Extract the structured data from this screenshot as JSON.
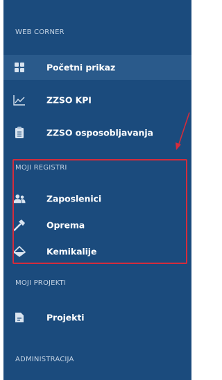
{
  "sidebar": {
    "sections": [
      {
        "header": "WEB CORNER",
        "items": [
          {
            "label": "Početni prikaz",
            "icon": "dashboard-icon"
          },
          {
            "label": "ZZSO KPI",
            "icon": "line-chart-icon"
          },
          {
            "label": "ZZSO osposobljavanja",
            "icon": "clipboard-icon"
          }
        ]
      },
      {
        "header": "MOJI REGISTRI",
        "items": [
          {
            "label": "Zaposlenici",
            "icon": "users-icon"
          },
          {
            "label": "Oprema",
            "icon": "hammer-icon"
          },
          {
            "label": "Kemikalije",
            "icon": "flask-icon"
          }
        ]
      },
      {
        "header": "MOJI PROJEKTI",
        "items": [
          {
            "label": "Projekti",
            "icon": "document-icon"
          }
        ]
      },
      {
        "header": "ADMINISTRACIJA",
        "items": []
      }
    ]
  },
  "colors": {
    "sidebar_bg": "#1b4b7d",
    "active_bg": "#2a5a8b",
    "highlight": "#d42c3c",
    "header_text": "#c4d3e4",
    "item_text": "#ffffff"
  }
}
